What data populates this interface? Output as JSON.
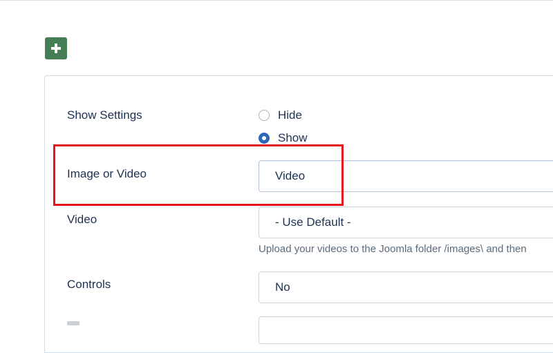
{
  "toolbar": {
    "add_icon": "plus-icon",
    "add_color": "#457d54"
  },
  "form": {
    "show_settings": {
      "label": "Show Settings",
      "options": [
        {
          "label": "Hide",
          "checked": false
        },
        {
          "label": "Show",
          "checked": true
        }
      ]
    },
    "image_or_video": {
      "label": "Image or Video",
      "value": "Video"
    },
    "video": {
      "label": "Video",
      "value": "- Use Default -",
      "help": "Upload your videos to the Joomla folder /images\\ and then"
    },
    "controls": {
      "label": "Controls",
      "value": "No"
    }
  },
  "annotation": {
    "highlight_color": "#e3151a"
  }
}
